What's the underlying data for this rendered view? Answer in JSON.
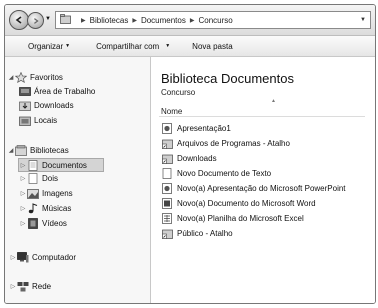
{
  "address": {
    "crumbs": [
      "Bibliotecas",
      "Documentos",
      "Concurso"
    ]
  },
  "toolbar": {
    "organize": "Organizar",
    "share": "Compartilhar com",
    "new_folder": "Nova pasta"
  },
  "nav": {
    "favorites": {
      "label": "Favoritos",
      "items": [
        "Área de Trabalho",
        "Downloads",
        "Locais"
      ]
    },
    "libraries": {
      "label": "Bibliotecas",
      "items": [
        "Documentos",
        "Dois",
        "Imagens",
        "Músicas",
        "Vídeos"
      ],
      "selected": "Documentos"
    },
    "computer": "Computador",
    "network": "Rede"
  },
  "main": {
    "title": "Biblioteca  Documentos",
    "subtitle": "Concurso",
    "column_name": "Nome",
    "files": [
      {
        "name": "Apresentação1",
        "icon": "pptx-icon"
      },
      {
        "name": "Arquivos de Programas - Atalho",
        "icon": "shortcut-icon"
      },
      {
        "name": "Downloads",
        "icon": "shortcut-icon"
      },
      {
        "name": "Novo Documento de Texto",
        "icon": "text-file-icon"
      },
      {
        "name": "Novo(a) Apresentação do Microsoft PowerPoint",
        "icon": "pptx-icon"
      },
      {
        "name": "Novo(a) Documento do Microsoft Word",
        "icon": "docx-icon"
      },
      {
        "name": "Novo(a) Planilha do Microsoft Excel",
        "icon": "xlsx-icon"
      },
      {
        "name": "Público - Atalho",
        "icon": "shortcut-icon"
      }
    ]
  }
}
